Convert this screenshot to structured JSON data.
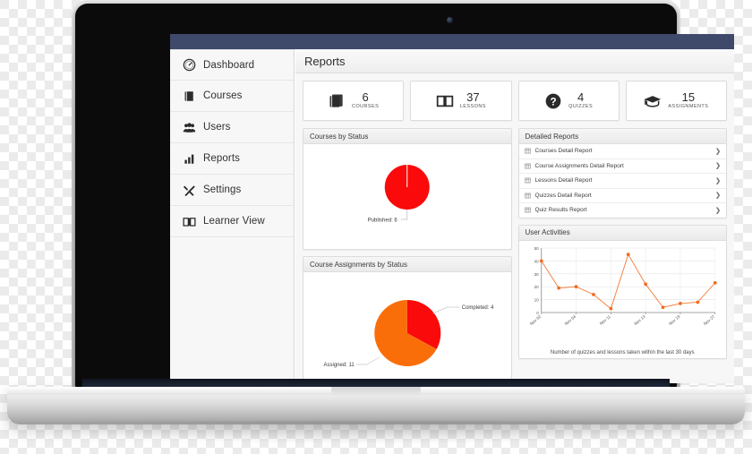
{
  "topbar": {
    "color": "#3f4a6b"
  },
  "page": {
    "title": "Reports"
  },
  "sidebar": {
    "items": [
      {
        "label": "Dashboard",
        "icon": "gauge-icon"
      },
      {
        "label": "Courses",
        "icon": "book-icon"
      },
      {
        "label": "Users",
        "icon": "users-icon"
      },
      {
        "label": "Reports",
        "icon": "bar-chart-icon"
      },
      {
        "label": "Settings",
        "icon": "tools-icon"
      },
      {
        "label": "Learner View",
        "icon": "open-book-icon"
      }
    ]
  },
  "stats": [
    {
      "value": "6",
      "label": "COURSES",
      "icon": "books-icon"
    },
    {
      "value": "37",
      "label": "LESSONS",
      "icon": "open-book-icon"
    },
    {
      "value": "4",
      "label": "QUIZZES",
      "icon": "question-mark-icon"
    },
    {
      "value": "15",
      "label": "ASSIGNMENTS",
      "icon": "graduation-cap-icon"
    }
  ],
  "panels": {
    "courses_by_status": {
      "title": "Courses by Status"
    },
    "course_assignments_by_status": {
      "title": "Course Assignments by Status"
    },
    "detailed_reports": {
      "title": "Detailed Reports",
      "rows": [
        {
          "label": "Courses Detail Report",
          "icon": "table-icon",
          "arrow": "❯"
        },
        {
          "label": "Course Assignments Detail Report",
          "icon": "table-icon",
          "arrow": "❯"
        },
        {
          "label": "Lessons Detail Report",
          "icon": "table-icon",
          "arrow": "❯"
        },
        {
          "label": "Quizzes Detail Report",
          "icon": "table-icon",
          "arrow": "❯"
        },
        {
          "label": "Quiz Results Report",
          "icon": "table-icon",
          "arrow": "❯"
        }
      ]
    },
    "user_activities": {
      "title": "User Activities",
      "caption": "Number of quizzes and lessons taken within the last 30 days"
    }
  },
  "chart_data": [
    {
      "type": "pie",
      "title": "Courses by Status",
      "labels": [
        "Published"
      ],
      "values": [
        6
      ],
      "annotations": [
        "Published: 6"
      ],
      "colors": [
        "#fa0a0a"
      ],
      "legend": "none"
    },
    {
      "type": "pie",
      "title": "Course Assignments by Status",
      "labels": [
        "Completed",
        "Assigned"
      ],
      "values": [
        4,
        11
      ],
      "annotations": [
        "Completed: 4",
        "Assigned: 11"
      ],
      "colors": [
        "#fa0a0a",
        "#fa6e0a"
      ],
      "legend": "none"
    },
    {
      "type": "line",
      "title": "User Activities",
      "xlabel": "",
      "ylabel": "",
      "caption": "Number of quizzes and lessons taken within the last 30 days",
      "ylim": [
        0,
        50
      ],
      "yticks": [
        0,
        10,
        20,
        30,
        40,
        50
      ],
      "tick_labels": [
        "Nov 02",
        "Nov 04",
        "Nov 11",
        "Nov 13",
        "Nov 19",
        "Nov 27"
      ],
      "x": [
        0,
        1,
        2,
        3,
        4,
        5,
        6,
        7,
        8,
        9,
        10
      ],
      "values": [
        40,
        19,
        20,
        14,
        3,
        45,
        22,
        4,
        7,
        8,
        23
      ],
      "color": "#f26c22",
      "grid": true,
      "legend": "none"
    }
  ]
}
